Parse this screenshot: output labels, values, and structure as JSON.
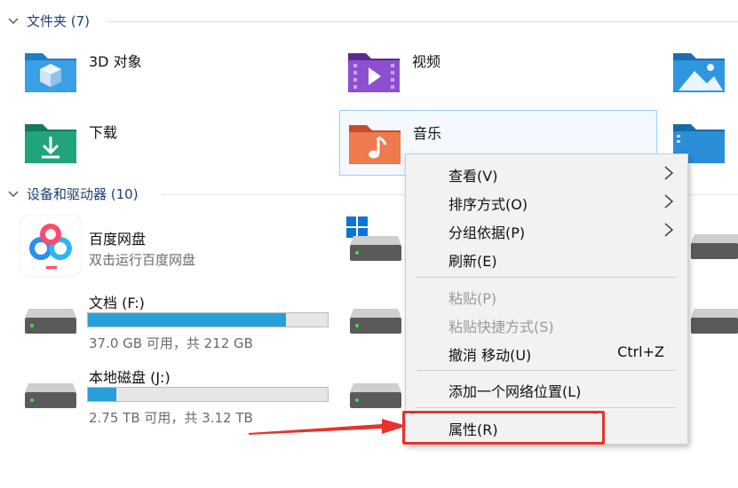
{
  "sections": {
    "folders": {
      "title": "文件夹 (7)"
    },
    "devices": {
      "title": "设备和驱动器 (10)"
    }
  },
  "folders": [
    {
      "label": "3D 对象",
      "icon": "3d-objects-folder-icon"
    },
    {
      "label": "视频",
      "icon": "videos-folder-icon"
    },
    {
      "label": "下载",
      "icon": "downloads-folder-icon"
    },
    {
      "label": "音乐",
      "icon": "music-folder-icon"
    }
  ],
  "devices": [
    {
      "label": "百度网盘",
      "sub": "双击运行百度网盘",
      "icon": "baidu-netdisk-icon"
    },
    {
      "label": "文档 (F:)",
      "sub": "37.0 GB 可用，共 212 GB",
      "used_fraction": 0.825,
      "icon": "drive-icon"
    },
    {
      "label": "本地磁盘 (J:)",
      "sub": "2.75 TB 可用，共 3.12 TB",
      "used_fraction": 0.119,
      "icon": "drive-icon"
    }
  ],
  "context_menu": {
    "items": [
      {
        "label": "查看(V)",
        "submenu": true,
        "disabled": false
      },
      {
        "label": "排序方式(O)",
        "submenu": true,
        "disabled": false
      },
      {
        "label": "分组依据(P)",
        "submenu": true,
        "disabled": false
      },
      {
        "label": "刷新(E)",
        "submenu": false,
        "disabled": false
      },
      {
        "label": "粘贴(P)",
        "submenu": false,
        "disabled": true
      },
      {
        "label": "粘贴快捷方式(S)",
        "submenu": false,
        "disabled": true
      },
      {
        "label": "撤消 移动(U)",
        "shortcut": "Ctrl+Z",
        "submenu": false,
        "disabled": false
      },
      {
        "label": "添加一个网络位置(L)",
        "submenu": false,
        "disabled": false
      },
      {
        "label": "属性(R)",
        "submenu": false,
        "disabled": false
      }
    ]
  },
  "colors": {
    "accent": "#26a0da",
    "annotation": "#e8322c",
    "section_text": "#1f3f73"
  }
}
